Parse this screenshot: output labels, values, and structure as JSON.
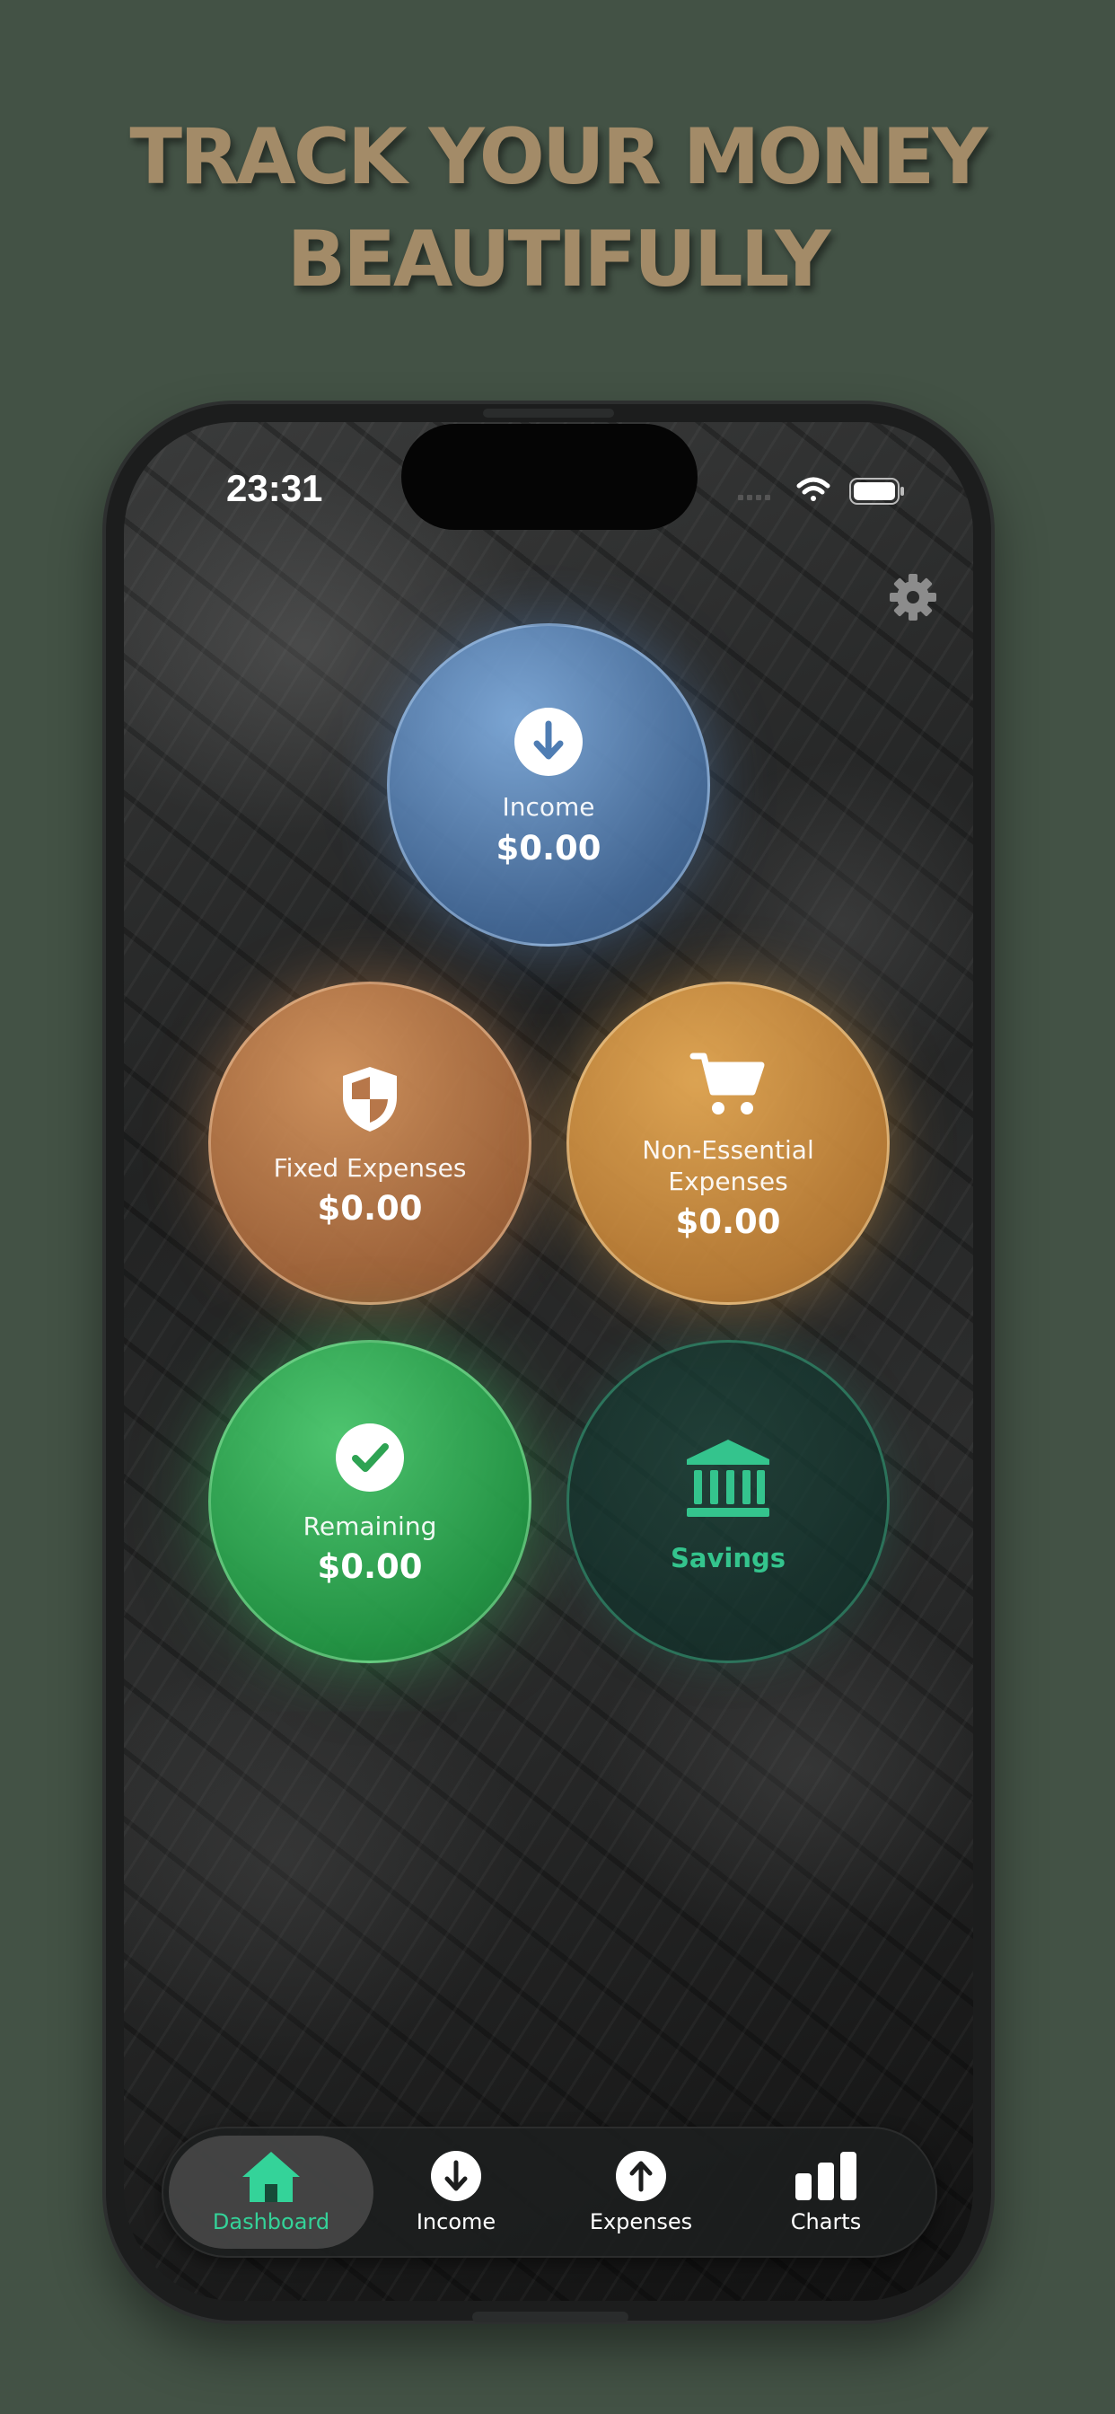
{
  "headline": {
    "line1": "TRACK YOUR MONEY",
    "line2": "BEAUTIFULLY"
  },
  "status_bar": {
    "time": "23:31"
  },
  "cards": {
    "income": {
      "label": "Income",
      "amount": "$0.00",
      "icon": "arrow-down-circle-icon",
      "color": "#6e9fd6"
    },
    "fixed": {
      "label": "Fixed Expenses",
      "amount": "$0.00",
      "icon": "shield-icon",
      "color": "#c98754"
    },
    "nonessential": {
      "label_line1": "Non-Essential",
      "label_line2": "Expenses",
      "amount": "$0.00",
      "icon": "cart-icon",
      "color": "#e0a152"
    },
    "remaining": {
      "label": "Remaining",
      "amount": "$0.00",
      "icon": "checkmark-circle-icon",
      "color": "#3fbf65"
    },
    "savings": {
      "label": "Savings",
      "icon": "bank-icon",
      "color": "#34c48d"
    }
  },
  "tabbar": {
    "active_color": "#34d399",
    "items": [
      {
        "label": "Dashboard",
        "icon": "house-icon",
        "active": true
      },
      {
        "label": "Income",
        "icon": "arrow-down-circle-icon",
        "active": false
      },
      {
        "label": "Expenses",
        "icon": "arrow-up-circle-icon",
        "active": false
      },
      {
        "label": "Charts",
        "icon": "bar-chart-icon",
        "active": false
      }
    ]
  },
  "colors": {
    "background": "#435245",
    "headline": "#a38b68"
  }
}
